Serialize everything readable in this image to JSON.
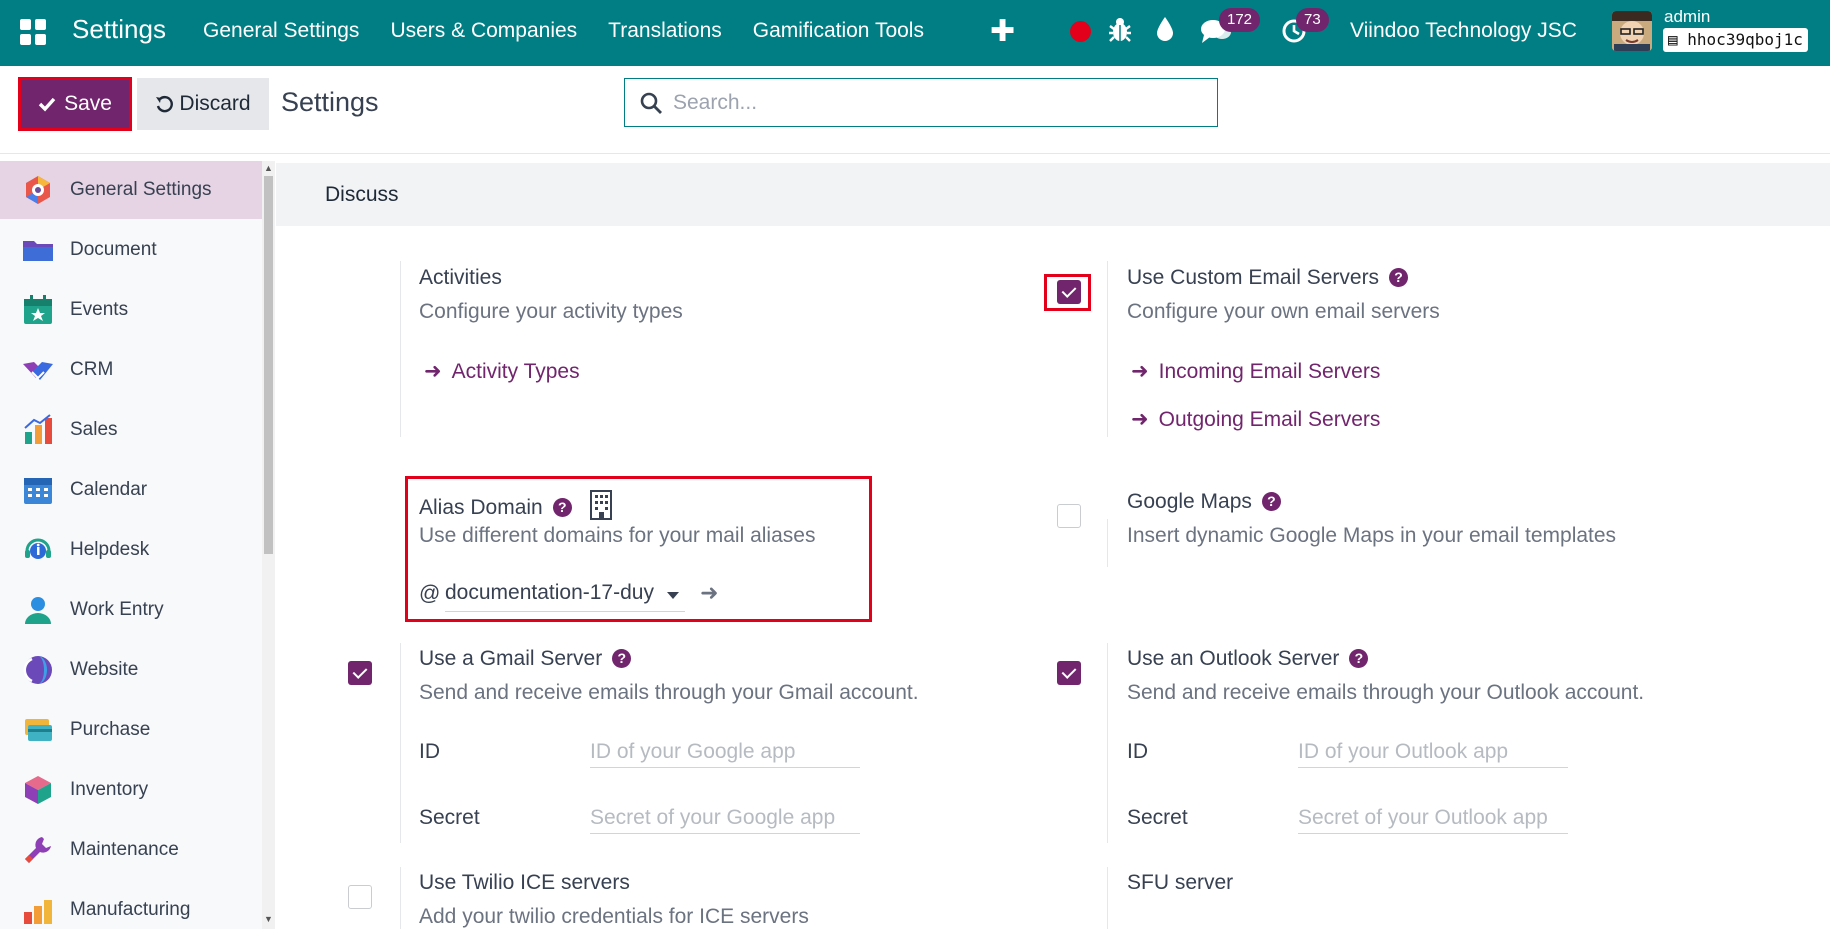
{
  "navbar": {
    "brand": "Settings",
    "menu": [
      "General Settings",
      "Users & Companies",
      "Translations",
      "Gamification Tools"
    ],
    "chat_count": "172",
    "activity_count": "73",
    "company": "Viindoo Technology JSC",
    "user": "admin",
    "database": "hhoc39qboj1c"
  },
  "controls": {
    "save_label": "Save",
    "discard_label": "Discard",
    "title": "Settings",
    "search_placeholder": "Search..."
  },
  "sidebar": {
    "items": [
      {
        "label": "General Settings",
        "icon": "general-settings-icon",
        "active": true
      },
      {
        "label": "Document",
        "icon": "folder-icon"
      },
      {
        "label": "Events",
        "icon": "events-calendar-icon"
      },
      {
        "label": "CRM",
        "icon": "crm-handshake-icon"
      },
      {
        "label": "Sales",
        "icon": "sales-chart-icon"
      },
      {
        "label": "Calendar",
        "icon": "calendar-icon"
      },
      {
        "label": "Helpdesk",
        "icon": "helpdesk-headset-icon"
      },
      {
        "label": "Work Entry",
        "icon": "work-entry-person-icon"
      },
      {
        "label": "Website",
        "icon": "website-globe-icon"
      },
      {
        "label": "Purchase",
        "icon": "purchase-card-icon"
      },
      {
        "label": "Inventory",
        "icon": "inventory-box-icon"
      },
      {
        "label": "Maintenance",
        "icon": "maintenance-wrench-icon"
      },
      {
        "label": "Manufacturing",
        "icon": "manufacturing-factory-icon"
      }
    ]
  },
  "section": {
    "title": "Discuss"
  },
  "settings": {
    "activities": {
      "title": "Activities",
      "desc": "Configure your activity types",
      "link": "Activity Types"
    },
    "custom_email": {
      "title": "Use Custom Email Servers",
      "desc": "Configure your own email servers",
      "links": [
        "Incoming Email Servers",
        "Outgoing Email Servers"
      ],
      "checked": true
    },
    "alias_domain": {
      "title": "Alias Domain",
      "desc": "Use different domains for your mail aliases",
      "prefix": "@",
      "value": "documentation-17-duy"
    },
    "google_maps": {
      "title": "Google Maps",
      "desc": "Insert dynamic Google Maps in your email templates",
      "checked": false
    },
    "gmail": {
      "title": "Use a Gmail Server",
      "desc": "Send and receive emails through your Gmail account.",
      "id_label": "ID",
      "id_placeholder": "ID of your Google app",
      "secret_label": "Secret",
      "secret_placeholder": "Secret of your Google app",
      "checked": true
    },
    "outlook": {
      "title": "Use an Outlook Server",
      "desc": "Send and receive emails through your Outlook account.",
      "id_label": "ID",
      "id_placeholder": "ID of your Outlook app",
      "secret_label": "Secret",
      "secret_placeholder": "Secret of your Outlook app",
      "checked": true
    },
    "twilio": {
      "title": "Use Twilio ICE servers",
      "desc": "Add your twilio credentials for ICE servers",
      "checked": false
    },
    "sfu": {
      "title": "SFU server"
    }
  },
  "colors": {
    "navbar": "#017e84",
    "primary": "#71256d",
    "highlight": "#e3001b"
  }
}
